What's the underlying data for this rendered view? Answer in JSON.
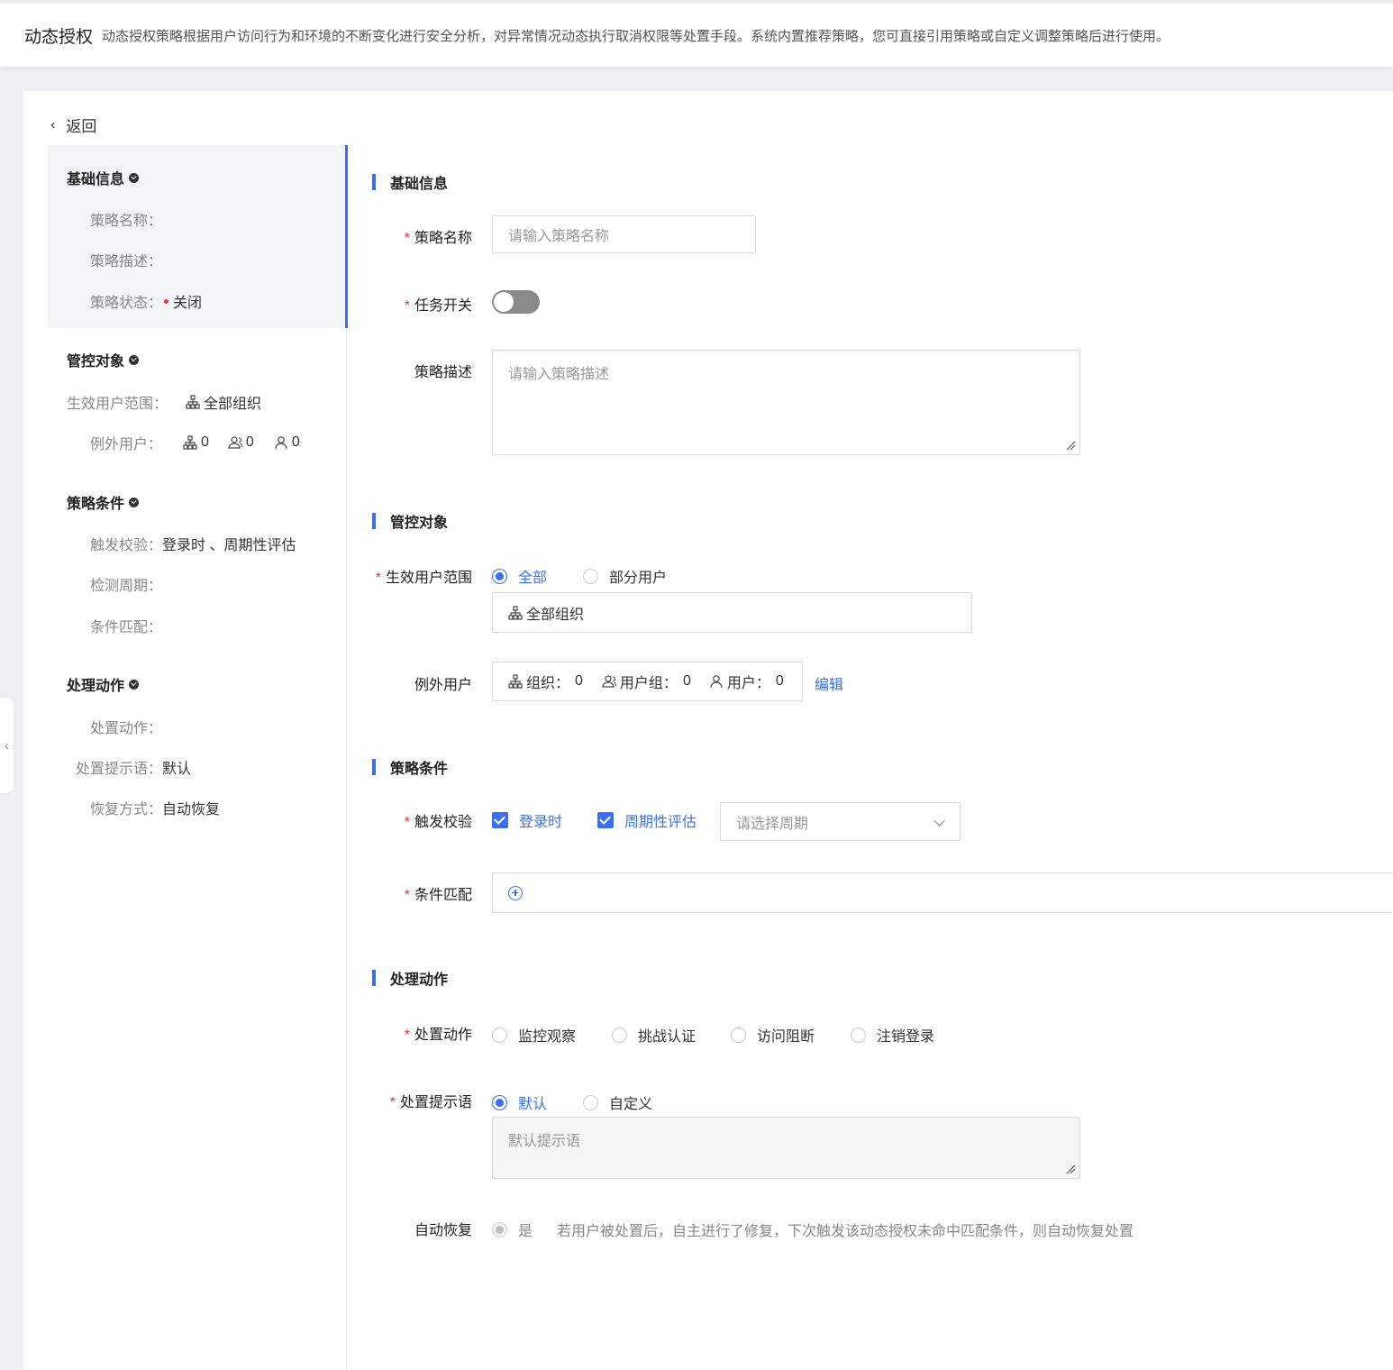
{
  "header": {
    "title": "动态授权",
    "description": "动态授权策略根据用户访问行为和环境的不断变化进行安全分析，对异常情况动态执行取消权限等处置手段。系统内置推荐策略，您可直接引用策略或自定义调整策略后进行使用。"
  },
  "back_label": "返回",
  "summary": {
    "basic": {
      "title": "基础信息",
      "name_label": "策略名称：",
      "desc_label": "策略描述：",
      "status_label": "策略状态：",
      "status_value": "关闭"
    },
    "target": {
      "title": "管控对象",
      "scope_label": "生效用户范围：",
      "scope_value": "全部组织",
      "except_label": "例外用户：",
      "org_count": "0",
      "group_count": "0",
      "user_count": "0"
    },
    "condition": {
      "title": "策略条件",
      "trigger_label": "触发校验：",
      "trigger_value": "登录时 、周期性评估",
      "period_label": "检测周期：",
      "match_label": "条件匹配："
    },
    "action": {
      "title": "处理动作",
      "action_label": "处置动作：",
      "prompt_label": "处置提示语：",
      "prompt_value": "默认",
      "recover_label": "恢复方式：",
      "recover_value": "自动恢复"
    }
  },
  "form": {
    "basic": {
      "title": "基础信息",
      "name_label": "策略名称",
      "name_placeholder": "请输入策略名称",
      "switch_label": "任务开关",
      "switch_on": false,
      "desc_label": "策略描述",
      "desc_placeholder": "请输入策略描述"
    },
    "target": {
      "title": "管控对象",
      "scope_label": "生效用户范围",
      "scope_all": "全部",
      "scope_partial": "部分用户",
      "scope_selected": "全部",
      "scope_value": "全部组织",
      "except_label": "例外用户",
      "org_label": "组织：",
      "org_count": "0",
      "group_label": "用户组：",
      "group_count": "0",
      "user_label": "用户：",
      "user_count": "0",
      "edit_label": "编辑"
    },
    "condition": {
      "title": "策略条件",
      "trigger_label": "触发校验",
      "trigger_login": "登录时",
      "trigger_periodic": "周期性评估",
      "period_placeholder": "请选择周期",
      "match_label": "条件匹配"
    },
    "action": {
      "title": "处理动作",
      "action_label": "处置动作",
      "actions": [
        "监控观察",
        "挑战认证",
        "访问阻断",
        "注销登录"
      ],
      "prompt_label": "处置提示语",
      "prompt_default": "默认",
      "prompt_custom": "自定义",
      "prompt_selected": "默认",
      "prompt_placeholder": "默认提示语",
      "recover_label": "自动恢复",
      "recover_yes": "是",
      "recover_hint": "若用户被处置后，自主进行了修复，下次触发该动态授权未命中匹配条件，则自动恢复处置"
    }
  },
  "colors": {
    "accent": "#3a6ff2",
    "required": "#e33333"
  }
}
